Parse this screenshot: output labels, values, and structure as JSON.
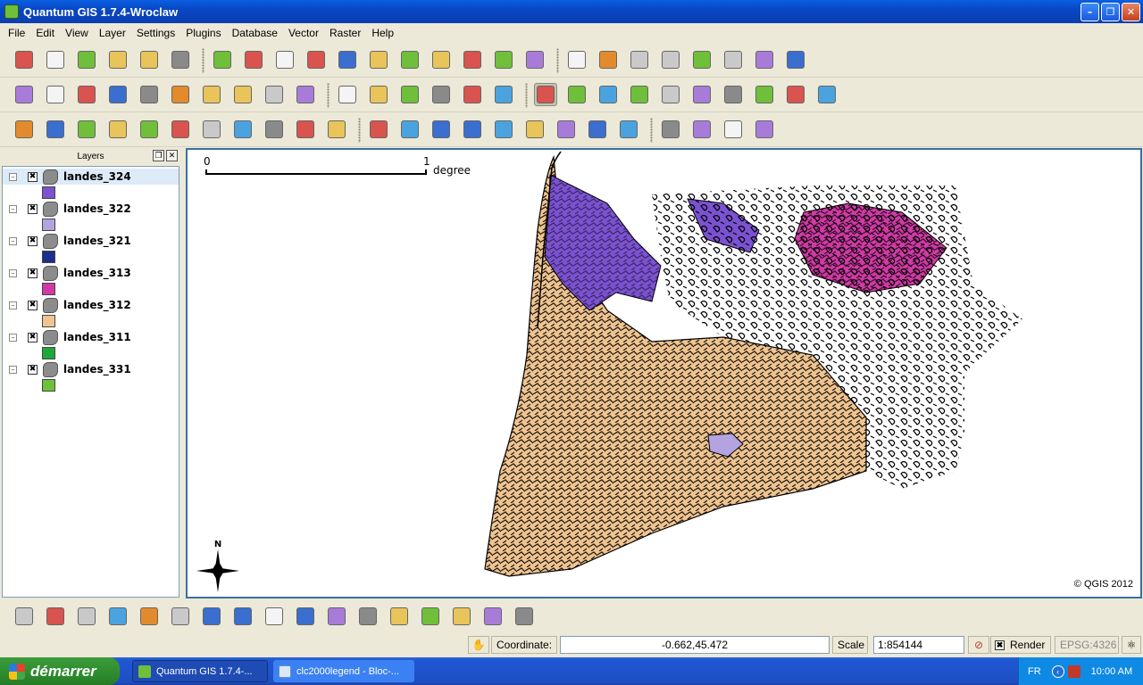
{
  "window": {
    "title": "Quantum GIS 1.7.4-Wroclaw"
  },
  "menu": [
    "File",
    "Edit",
    "View",
    "Layer",
    "Settings",
    "Plugins",
    "Database",
    "Vector",
    "Raster",
    "Help"
  ],
  "layers_panel": {
    "title": "Layers",
    "layers": [
      {
        "name": "landes_324",
        "color": "#7b52d1",
        "checked": "✖"
      },
      {
        "name": "landes_322",
        "color": "#b3a4e0",
        "checked": "✖"
      },
      {
        "name": "landes_321",
        "color": "#1c2f8c",
        "checked": "✖"
      },
      {
        "name": "landes_313",
        "color": "#d13aa6",
        "checked": "✖"
      },
      {
        "name": "landes_312",
        "color": "#f0c490",
        "checked": "✖"
      },
      {
        "name": "landes_311",
        "color": "#1fa83a",
        "checked": "✖"
      },
      {
        "name": "landes_331",
        "color": "#6cc23a",
        "checked": "✖"
      }
    ]
  },
  "map": {
    "scalebar": {
      "zero": "0",
      "one": "1",
      "unit": "degree"
    },
    "copyright": "© QGIS 2012",
    "north_label": "N"
  },
  "statusbar": {
    "coordinate_label": "Coordinate:",
    "coordinate_value": "-0.662,45.472",
    "scale_label": "Scale",
    "scale_value": "1:854144",
    "render_label": "Render",
    "render_checked": "✖",
    "crs": "EPSG:4326"
  },
  "taskbar": {
    "start_label": "démarrer",
    "tasks": [
      "Quantum GIS 1.7.4-...",
      "clc2000legend - Bloc-..."
    ],
    "lang": "FR",
    "clock": "10:00 AM"
  },
  "toolbar_icons": {
    "row1": [
      "new-project-icon",
      "open-project-icon",
      "save-project-icon",
      "save-as-icon",
      "print-composer-icon",
      "print-icon",
      "add-vector-icon",
      "add-raster-icon",
      "add-postgis-icon",
      "add-spatialite-icon",
      "add-wms-icon",
      "new-shapefile-icon",
      "remove-layer-icon",
      "add-wfs-icon",
      "add-mssql-icon",
      "gps-icon",
      "globe-icon",
      "toggle-editing-icon",
      "save-edits-icon",
      "move-feature-icon",
      "node-tool-icon",
      "delete-selected-icon",
      "cut-icon",
      "copy-icon",
      "paste-icon"
    ],
    "row2": [
      "capture-point-icon",
      "capture-line-icon",
      "capture-polygon-icon",
      "add-ring-icon",
      "add-part-icon",
      "fill-ring-icon",
      "simplify-icon",
      "split-icon",
      "merge-icon",
      "offset-icon",
      "label-icon",
      "pin-icon",
      "rotate-label-icon",
      "label-props-icon",
      "histogram-icon",
      "stretch-icon",
      "pan-icon",
      "zoom-in-icon",
      "zoom-out-icon",
      "zoom-native-icon",
      "zoom-full-icon",
      "zoom-layer-icon",
      "zoom-selection-icon",
      "zoom-last-icon",
      "zoom-next-icon",
      "refresh-icon"
    ],
    "row3": [
      "undo-icon",
      "redo-icon",
      "rotate-point-icon",
      "reshape-icon",
      "rotate-icon",
      "simplify-feature-icon",
      "delete-ring-icon",
      "delete-part-icon",
      "reshape-features-icon",
      "split-features-icon",
      "merge-attributes-icon",
      "identify-icon",
      "select-icon",
      "deselect-icon",
      "attribute-table-icon",
      "measure-icon",
      "map-tips-icon",
      "bookmark-new-icon",
      "bookmark-show-icon",
      "text-annotation-icon",
      "new-spatialite-layer-icon",
      "layer-info-icon",
      "map-layer-icon",
      "more-icon"
    ],
    "plugins": [
      "copyright-icon",
      "coordinate-capture-icon",
      "d2s-icon",
      "georeferencer-icon",
      "grass-vector-icon",
      "raster-terrain-icon",
      "wms-globe-icon",
      "histogram-plugin-icon",
      "north-arrow-icon",
      "db-manager-icon",
      "interpolation-icon",
      "heatmap-icon",
      "shape-edit-icon",
      "scale-bar-icon",
      "spit-icon",
      "elephant-icon",
      "image-plugin-icon"
    ]
  }
}
